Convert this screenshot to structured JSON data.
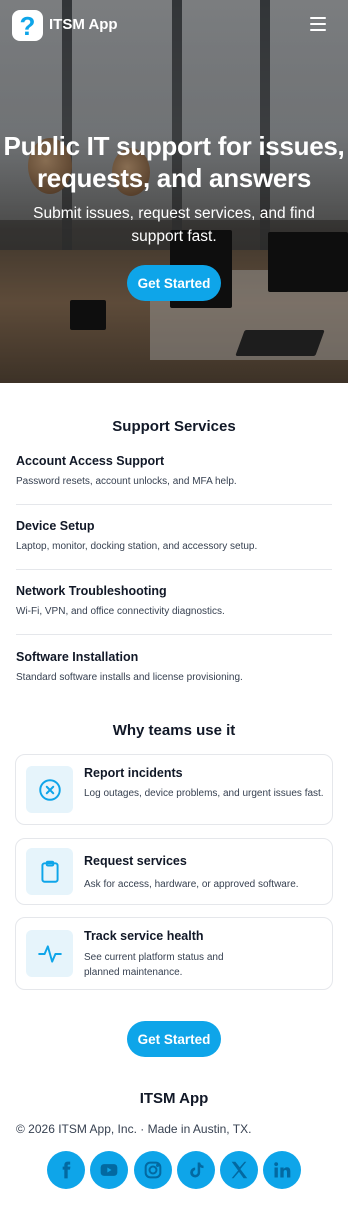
{
  "nav": {
    "brand": "ITSM App",
    "logo_glyph": "?",
    "menu_icon": "hamburger-icon"
  },
  "hero": {
    "title_line1": "Public IT support for issues,",
    "title_line2": "requests, and answers",
    "subtitle_line1": "Submit issues, request services, and find",
    "subtitle_line2": "support fast.",
    "cta": "Get Started"
  },
  "services": {
    "title": "Support Services",
    "items": [
      {
        "name": "Account Access Support",
        "desc": "Password resets, account unlocks, and MFA help."
      },
      {
        "name": "Device Setup",
        "desc": "Laptop, monitor, docking station, and accessory setup."
      },
      {
        "name": "Network Troubleshooting",
        "desc": "Wi-Fi, VPN, and office connectivity diagnostics."
      },
      {
        "name": "Software Installation",
        "desc": "Standard software installs and license provisioning."
      }
    ]
  },
  "why": {
    "title": "Why teams use it",
    "cards": [
      {
        "icon": "x-circle-icon",
        "title": "Report incidents",
        "desc": "Log outages, device problems, and urgent issues fast."
      },
      {
        "icon": "clipboard-icon",
        "title": "Request services",
        "desc": "Ask for access, hardware, or approved software."
      },
      {
        "icon": "activity-icon",
        "title": "Track service health",
        "desc": "See current platform status and planned maintenance."
      }
    ]
  },
  "footer": {
    "cta": "Get Started",
    "brand": "ITSM App",
    "copyright": "© 2026 ITSM App, Inc. · Made in Austin, TX.",
    "social": [
      "facebook-icon",
      "youtube-icon",
      "instagram-icon",
      "tiktok-icon",
      "x-icon",
      "linkedin-icon"
    ]
  },
  "colors": {
    "accent": "#0ea5e9",
    "icon_bg": "#e6f4fb",
    "text": "#111827",
    "muted": "#374151"
  }
}
